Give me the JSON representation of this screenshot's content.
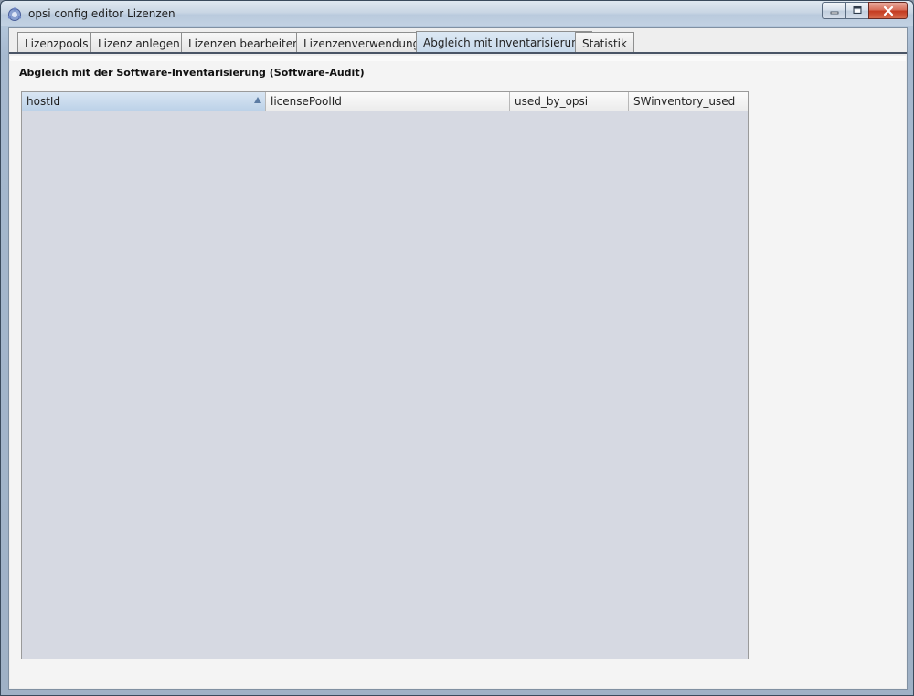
{
  "window": {
    "title": "opsi config editor Lizenzen",
    "icon": "opsi-app-icon",
    "controls": [
      "minimize",
      "maximize",
      "close"
    ]
  },
  "tabs": [
    {
      "label": "Lizenzpools",
      "active": false
    },
    {
      "label": "Lizenz anlegen",
      "active": false
    },
    {
      "label": "Lizenzen bearbeiten",
      "active": false
    },
    {
      "label": "Lizenzenverwendung",
      "active": false
    },
    {
      "label": "Abgleich mit Inventarisierung",
      "active": true
    },
    {
      "label": "Statistik",
      "active": false
    }
  ],
  "panel": {
    "title": "Abgleich mit der Software-Inventarisierung (Software-Audit)"
  },
  "table": {
    "columns": [
      {
        "label": "hostId",
        "sorted": "ascending"
      },
      {
        "label": "licensePoolId"
      },
      {
        "label": "used_by_opsi"
      },
      {
        "label": "SWinventory_used"
      }
    ],
    "rows": []
  },
  "colors": {
    "accent": "#c6d8ea",
    "table_background": "#d6d9e2",
    "close_button": "#c43b20"
  }
}
